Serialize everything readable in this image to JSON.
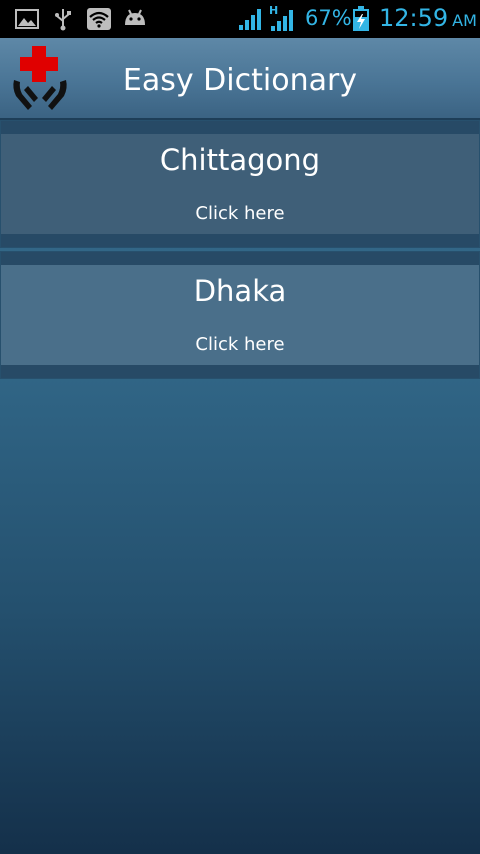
{
  "status_bar": {
    "battery_percent": "67%",
    "time": "12:59",
    "ampm": "AM",
    "network_type": "H",
    "icons": [
      "image-icon",
      "usb-icon",
      "wifi-icon",
      "android-icon",
      "signal-icon",
      "signal-h-icon",
      "battery-charging-icon"
    ],
    "accent_color": "#33b5e5"
  },
  "app_bar": {
    "title": "Easy Dictionary",
    "logo_icon": "medical-cross-hands-icon"
  },
  "cities": [
    {
      "name": "Chittagong",
      "action_label": "Click here"
    },
    {
      "name": "Dhaka",
      "action_label": "Click here"
    }
  ]
}
